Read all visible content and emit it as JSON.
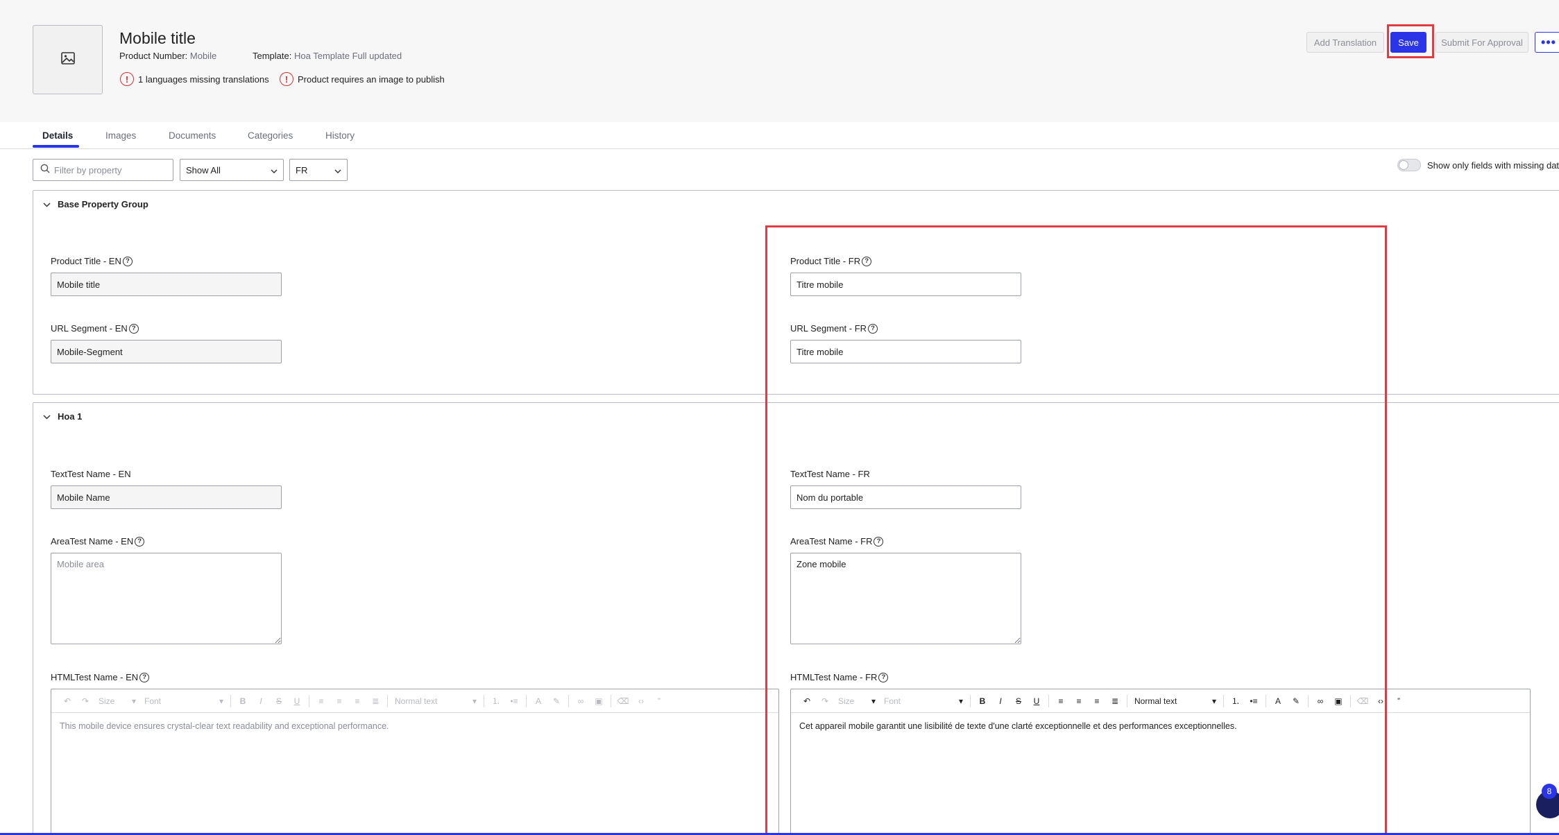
{
  "product": {
    "title": "Mobile title",
    "product_number_label": "Product Number:",
    "product_number_value": "Mobile",
    "template_label": "Template:",
    "template_value": "Hoa Template Full updated",
    "warnings": [
      "1 languages missing translations",
      "Product requires an image to publish"
    ]
  },
  "actions": {
    "add_translation": "Add Translation",
    "save": "Save",
    "submit": "Submit For Approval",
    "more": "•••"
  },
  "tabs": [
    "Details",
    "Images",
    "Documents",
    "Categories",
    "History"
  ],
  "filters": {
    "search_placeholder": "Filter by property",
    "show_select": "Show All",
    "lang_select": "FR",
    "toggle_label": "Show only fields with missing data"
  },
  "groups": {
    "base": {
      "title": "Base Property Group",
      "product_title_en_label": "Product Title - EN",
      "product_title_en_value": "Mobile title",
      "product_title_fr_label": "Product Title - FR",
      "product_title_fr_value": "Titre mobile",
      "url_en_label": "URL Segment - EN",
      "url_en_value": "Mobile-Segment",
      "url_fr_label": "URL Segment - FR",
      "url_fr_value": "Titre mobile"
    },
    "hoa": {
      "title": "Hoa 1",
      "text_en_label": "TextTest Name - EN",
      "text_en_value": "Mobile Name",
      "text_fr_label": "TextTest Name - FR",
      "text_fr_value": "Nom du portable",
      "area_en_label": "AreaTest Name - EN",
      "area_en_placeholder": "Mobile area",
      "area_fr_label": "AreaTest Name - FR",
      "area_fr_value": "Zone mobile",
      "html_en_label": "HTMLTest Name - EN",
      "html_en_value": "This mobile device ensures crystal-clear text readability and exceptional performance.",
      "html_fr_label": "HTMLTest Name - FR",
      "html_fr_value": "Cet appareil mobile garantit une lisibilité de texte d'une clarté exceptionnelle et des performances exceptionnelles."
    }
  },
  "editor_toolbar": {
    "size": "Size",
    "font": "Font",
    "block": "Normal text"
  },
  "badge": "8"
}
